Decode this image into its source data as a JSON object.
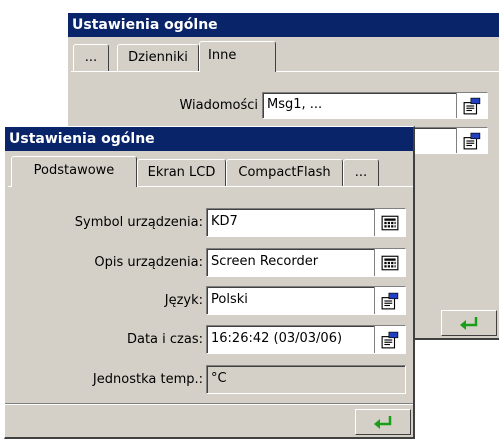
{
  "back_dialog": {
    "title": "Ustawienia ogólne",
    "tabs": [
      "...",
      "Dzienniki",
      "Inne"
    ],
    "messages_label": "Wiadomości",
    "messages_value": "Msg1, ...",
    "edit_icon": "edit-icon",
    "enter_icon": "enter-arrow-icon"
  },
  "front_dialog": {
    "title": "Ustawienia ogólne",
    "tabs": [
      "Podstawowe",
      "Ekran LCD",
      "CompactFlash",
      "..."
    ],
    "fields": [
      {
        "label": "Symbol urządzenia:",
        "value": "KD7",
        "icon": "keyboard-icon"
      },
      {
        "label": "Opis urządzenia:",
        "value": "Screen Recorder",
        "icon": "keyboard-icon"
      },
      {
        "label": "Język:",
        "value": "Polski",
        "icon": "edit-icon"
      },
      {
        "label": "Data i czas:",
        "value": "16:26:42 (03/03/06)",
        "icon": "edit-icon"
      },
      {
        "label": "Jednostka temp.:",
        "value": "°C"
      }
    ],
    "ok_icon": "enter-arrow-icon"
  },
  "colors": {
    "titlebar": "#0a246a",
    "dialog_bg": "#d4d0c8",
    "enter_arrow": "#1a9e1a"
  }
}
